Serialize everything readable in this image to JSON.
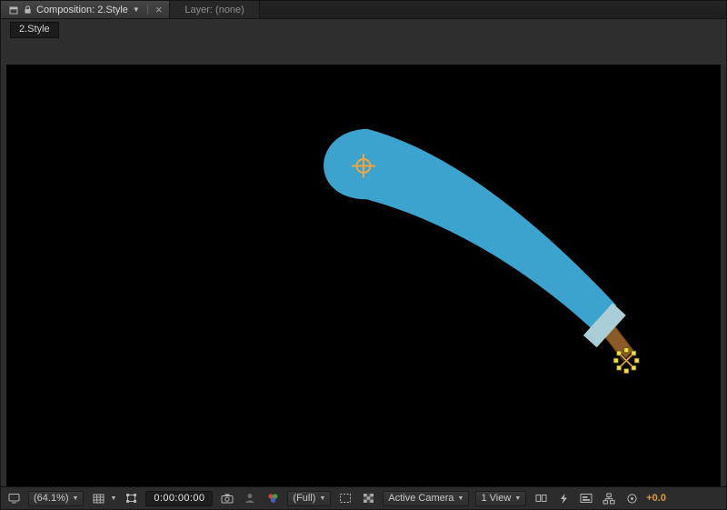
{
  "ui": {
    "caret": "▼",
    "close": "×"
  },
  "tabs": {
    "composition": {
      "label": "Composition: 2.Style"
    },
    "layer": {
      "label": "Layer: (none)"
    }
  },
  "breadcrumb": {
    "label": "2.Style"
  },
  "statusbar": {
    "magnification": "(64.1%)",
    "timecode": "0:00:00:00",
    "resolution": "(Full)",
    "camera_view": "Active Camera",
    "view_layout": "1 View",
    "exposure": "+0.0"
  },
  "icons": {
    "panel_grip": "small-gray-square",
    "lock": "padlock",
    "always_preview": "monitor",
    "grid_and_guides": "grid-square",
    "mask_visibility": "square-with-vertex-dots",
    "snapshot": "camera",
    "show_snapshot": "person",
    "channels": "rgb-dots",
    "region_of_interest": "dashed-rect",
    "transparency_grid": "checkerboard",
    "pixel_aspect_correction": "double-rect",
    "fast_previews": "lightning-bolt",
    "timeline": "framed-bars",
    "flowchart": "node-tree",
    "reset_exposure": "aperture-circle"
  },
  "scene": {
    "background": "#000000",
    "blade_color": "#3BA3CD",
    "guard_color": "#ABCDD8",
    "handle_color": "#8A5B26",
    "handle_stroke": "#5E3A10",
    "anchor_color": "#F2A33C",
    "selection_fill": "#F0E14A",
    "selection_stroke": "#6B5C00",
    "selection_mark_dark": "#1d1205",
    "selection_mark_orange": "#e0a83c"
  }
}
